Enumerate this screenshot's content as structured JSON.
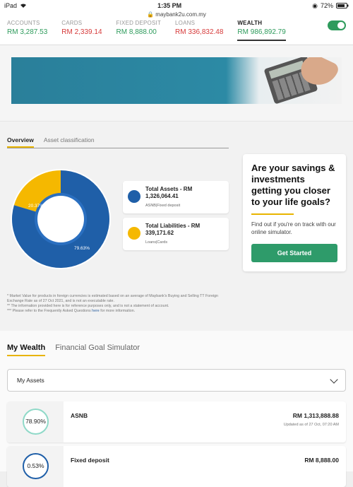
{
  "status": {
    "device": "iPad",
    "time": "1:35 PM",
    "battery": "72%",
    "url": "maybank2u.com.my"
  },
  "account_tabs": [
    {
      "name": "ACCOUNTS",
      "value": "RM 3,287.53"
    },
    {
      "name": "CARDS",
      "value": "RM 2,339.14"
    },
    {
      "name": "FIXED DEPOSIT",
      "value": "RM 8,888.00"
    },
    {
      "name": "LOANS",
      "value": "RM 336,832.48"
    },
    {
      "name": "WEALTH",
      "value": "RM 986,892.79"
    }
  ],
  "overview": {
    "tabs": [
      "Overview",
      "Asset classification"
    ],
    "chart": {
      "assets_pct": "79.63%",
      "liabilities_pct": "20.37%"
    },
    "assets": {
      "title": "Total Assets - RM 1,326,064.41",
      "sub": "ASNB|Fixed deposit"
    },
    "liabilities": {
      "title": "Total Liabilities - RM 339,171.62",
      "sub": "Loans|Cards"
    }
  },
  "promo": {
    "heading": "Are your savings & investments getting you closer to your life goals?",
    "text": "Find out if you're on track with our online simulator.",
    "button": "Get Started"
  },
  "disclaimer": {
    "line1": "* Market Value for products in foreign currencies is estimated based on an average of Maybank's Buying and Selling TT Foreign Exchange Rate as of 27 Oct 2021, and is not an executable rate.",
    "line2": "** The information provided here is for reference purposes only, and is not a statement of account.",
    "line3_pre": "*** Please refer to the Frequently Asked Questions",
    "line3_link": "here",
    "line3_post": "for more information."
  },
  "wealth": {
    "tabs": [
      "My Wealth",
      "Financial Goal Simulator"
    ],
    "select": "My Assets",
    "assets": [
      {
        "pct": "78.90%",
        "name": "ASNB",
        "amount": "RM 1,313,888.88",
        "updated": "Updated as of 27 Oct, 07:20 AM"
      },
      {
        "pct": "0.53%",
        "name": "Fixed deposit",
        "amount": "RM 8,888.00"
      }
    ]
  },
  "colors": {
    "green": "#2e9b5c",
    "red": "#d63a3a",
    "blue": "#1f5fa8",
    "yellow": "#f5b800"
  },
  "chart_data": {
    "type": "pie",
    "categories": [
      "Total Assets",
      "Total Liabilities"
    ],
    "values": [
      79.63,
      20.37
    ]
  }
}
